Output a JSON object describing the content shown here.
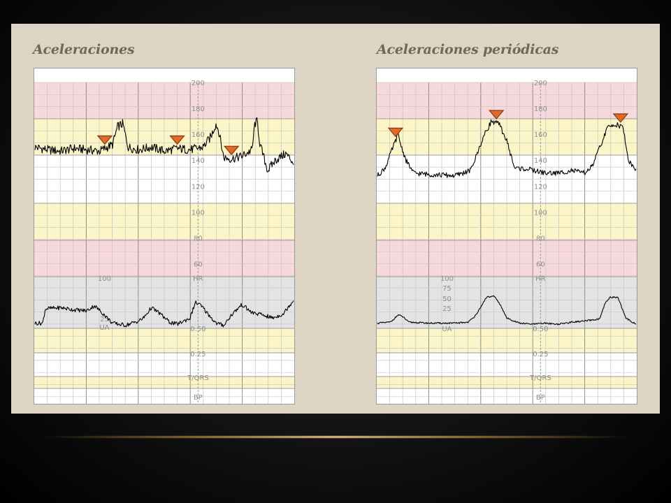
{
  "slide": {
    "title_left": "Aceleraciones",
    "title_right": "Aceleraciones periódicas"
  },
  "colors": {
    "slide_bg": "#ddd4c4",
    "band_pink": "#f6d8dd",
    "band_yellow": "#fbf5c8",
    "band_gray": "#e3e3e3",
    "trace": "#000000",
    "marker_fill": "#e06a2a",
    "marker_stroke": "#8a3a10",
    "glow": "#e8c486"
  },
  "chart_data": [
    {
      "type": "line",
      "title": "Aceleraciones",
      "fhr_ticks": [
        "200",
        "180",
        "160",
        "140",
        "120",
        "100",
        "80",
        "60"
      ],
      "uc_ticks_left": [
        "100",
        "25",
        "UA"
      ],
      "uc_ticks_right": [
        "HR",
        "0.50",
        "0.25",
        "T/QRS",
        "BP"
      ],
      "fhr_ylim": [
        50,
        200
      ],
      "series": [
        {
          "values": [
            [
              0,
              150
            ],
            [
              0.05,
              148
            ],
            [
              0.1,
              147
            ],
            [
              0.15,
              149
            ],
            [
              0.2,
              148
            ],
            [
              0.25,
              147
            ],
            [
              0.3,
              152
            ],
            [
              0.32,
              166
            ],
            [
              0.34,
              168
            ],
            [
              0.36,
              150
            ],
            [
              0.4,
              148
            ],
            [
              0.45,
              150
            ],
            [
              0.5,
              147
            ],
            [
              0.55,
              149
            ],
            [
              0.6,
              148
            ],
            [
              0.65,
              150
            ],
            [
              0.68,
              158
            ],
            [
              0.7,
              168
            ],
            [
              0.71,
              163
            ],
            [
              0.73,
              142
            ],
            [
              0.76,
              141
            ],
            [
              0.8,
              143
            ],
            [
              0.84,
              148
            ],
            [
              0.85,
              168
            ],
            [
              0.86,
              170
            ],
            [
              0.87,
              152
            ],
            [
              0.9,
              132
            ],
            [
              0.93,
              140
            ],
            [
              0.97,
              145
            ],
            [
              1.0,
              138
            ]
          ]
        },
        {
          "values": [
            [
              0,
              10
            ],
            [
              0.03,
              10
            ],
            [
              0.04,
              38
            ],
            [
              0.1,
              40
            ],
            [
              0.15,
              36
            ],
            [
              0.2,
              34
            ],
            [
              0.23,
              44
            ],
            [
              0.26,
              30
            ],
            [
              0.3,
              10
            ],
            [
              0.35,
              6
            ],
            [
              0.4,
              14
            ],
            [
              0.42,
              20
            ],
            [
              0.45,
              40
            ],
            [
              0.48,
              30
            ],
            [
              0.52,
              12
            ],
            [
              0.55,
              8
            ],
            [
              0.6,
              20
            ],
            [
              0.62,
              50
            ],
            [
              0.64,
              45
            ],
            [
              0.7,
              10
            ],
            [
              0.73,
              6
            ],
            [
              0.76,
              26
            ],
            [
              0.8,
              46
            ],
            [
              0.84,
              30
            ],
            [
              0.88,
              26
            ],
            [
              0.92,
              20
            ],
            [
              0.96,
              28
            ],
            [
              1.0,
              55
            ]
          ]
        }
      ],
      "markers_x": [
        0.27,
        0.55,
        0.76
      ]
    },
    {
      "type": "line",
      "title": "Aceleraciones periódicas",
      "fhr_ticks": [
        "200",
        "180",
        "160",
        "140",
        "120",
        "100",
        "80",
        "60"
      ],
      "uc_ticks_left": [
        "100",
        "75",
        "50",
        "25",
        "UA"
      ],
      "uc_ticks_right": [
        "HR",
        "0.50",
        "0.25",
        "T/QRS",
        "BP"
      ],
      "fhr_ylim": [
        50,
        200
      ],
      "series": [
        {
          "values": [
            [
              0,
              128
            ],
            [
              0.03,
              134
            ],
            [
              0.06,
              150
            ],
            [
              0.08,
              160
            ],
            [
              0.09,
              152
            ],
            [
              0.11,
              140
            ],
            [
              0.14,
              130
            ],
            [
              0.2,
              129
            ],
            [
              0.3,
              128
            ],
            [
              0.36,
              132
            ],
            [
              0.38,
              142
            ],
            [
              0.41,
              158
            ],
            [
              0.44,
              170
            ],
            [
              0.47,
              168
            ],
            [
              0.5,
              155
            ],
            [
              0.53,
              134
            ],
            [
              0.58,
              133
            ],
            [
              0.65,
              130
            ],
            [
              0.7,
              130
            ],
            [
              0.75,
              132
            ],
            [
              0.8,
              130
            ],
            [
              0.83,
              135
            ],
            [
              0.86,
              150
            ],
            [
              0.89,
              165
            ],
            [
              0.92,
              168
            ],
            [
              0.95,
              165
            ],
            [
              0.97,
              140
            ],
            [
              1.0,
              132
            ]
          ]
        },
        {
          "values": [
            [
              0,
              10
            ],
            [
              0.05,
              12
            ],
            [
              0.08,
              26
            ],
            [
              0.1,
              22
            ],
            [
              0.12,
              12
            ],
            [
              0.2,
              10
            ],
            [
              0.3,
              10
            ],
            [
              0.35,
              12
            ],
            [
              0.37,
              20
            ],
            [
              0.4,
              40
            ],
            [
              0.42,
              60
            ],
            [
              0.45,
              62
            ],
            [
              0.47,
              50
            ],
            [
              0.5,
              20
            ],
            [
              0.55,
              10
            ],
            [
              0.6,
              8
            ],
            [
              0.65,
              10
            ],
            [
              0.7,
              8
            ],
            [
              0.75,
              12
            ],
            [
              0.8,
              14
            ],
            [
              0.86,
              18
            ],
            [
              0.88,
              48
            ],
            [
              0.9,
              60
            ],
            [
              0.93,
              60
            ],
            [
              0.96,
              20
            ],
            [
              1.0,
              8
            ]
          ]
        }
      ],
      "markers_x": [
        0.07,
        0.46,
        0.94
      ]
    }
  ]
}
